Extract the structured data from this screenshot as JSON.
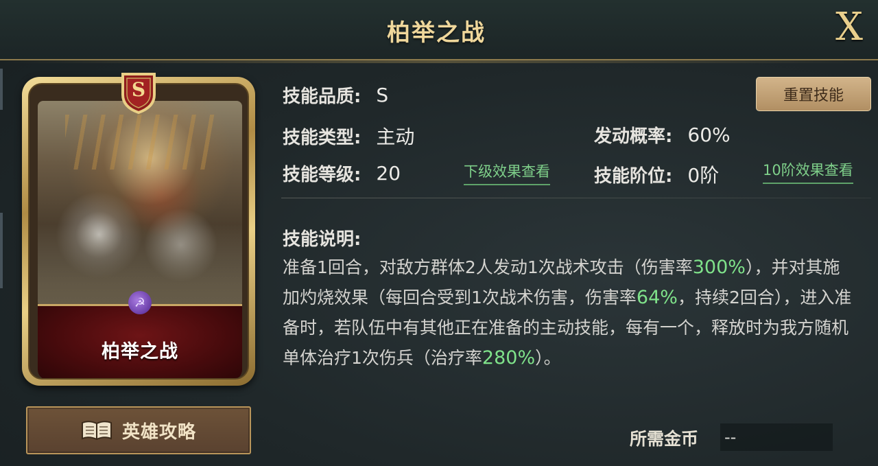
{
  "header": {
    "title": "柏举之战",
    "close_label": "X"
  },
  "card": {
    "rank": "S",
    "name": "柏举之战",
    "emblem": "☭"
  },
  "guide": {
    "label": "英雄攻略"
  },
  "skill": {
    "quality_label": "技能品质:",
    "quality_value": "S",
    "type_label": "技能类型:",
    "type_value": "主动",
    "level_label": "技能等级:",
    "level_value": "20",
    "next_level_link": "下级效果查看",
    "trigger_label": "发动概率:",
    "trigger_value": "60%",
    "tier_label": "技能阶位:",
    "tier_value": "0阶",
    "tier_link": "10阶效果查看",
    "reset_label": "重置技能",
    "desc_title": "技能说明:",
    "desc": {
      "p1": "准备1回合，对敌方群体2人发动1次战术攻击（伤害率",
      "v1": "300%",
      "p2": "），并对其施加灼烧效果（每回合受到1次战术伤害，伤害率",
      "v2": "64%",
      "p3": "，持续2回合），进入准备时，若队伍中有其他正在准备的主动技能，每有一个，释放时为我方随机单体治疗1次伤兵（治疗率",
      "v3": "280%",
      "p4": "）。"
    }
  },
  "cost": {
    "label": "所需金币",
    "value": "--"
  },
  "colors": {
    "gold": "#efd79b",
    "highlight": "#7fe28a",
    "link": "#7fd08a",
    "card_red": "#6d1416"
  },
  "icons": {
    "close": "close-icon",
    "book": "book-icon",
    "emblem": "skill-type-emblem-icon",
    "rank": "rank-shield-icon"
  }
}
